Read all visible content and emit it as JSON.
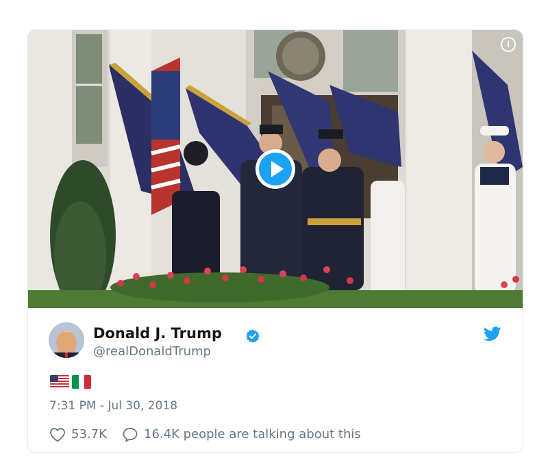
{
  "tweet": {
    "author_name": "Donald J. Trump",
    "author_handle": "@realDonaldTrump",
    "verified": true,
    "flags": [
      "🇺🇸",
      "🇮🇹"
    ],
    "timestamp": "7:31 PM - Jul 30, 2018",
    "likes": "53.7K",
    "replies_text": "16.4K people are talking about this"
  },
  "media": {
    "type": "video",
    "play_icon": "play-icon",
    "info_icon": "i"
  },
  "icons": {
    "brand": "twitter-bird-icon",
    "verified": "verified-badge-icon",
    "like": "heart-icon",
    "reply": "speech-bubble-icon"
  },
  "colors": {
    "twitter_blue": "#1da1f2",
    "text_primary": "#14171a",
    "text_secondary": "#657786",
    "border": "#e1e8ed"
  }
}
